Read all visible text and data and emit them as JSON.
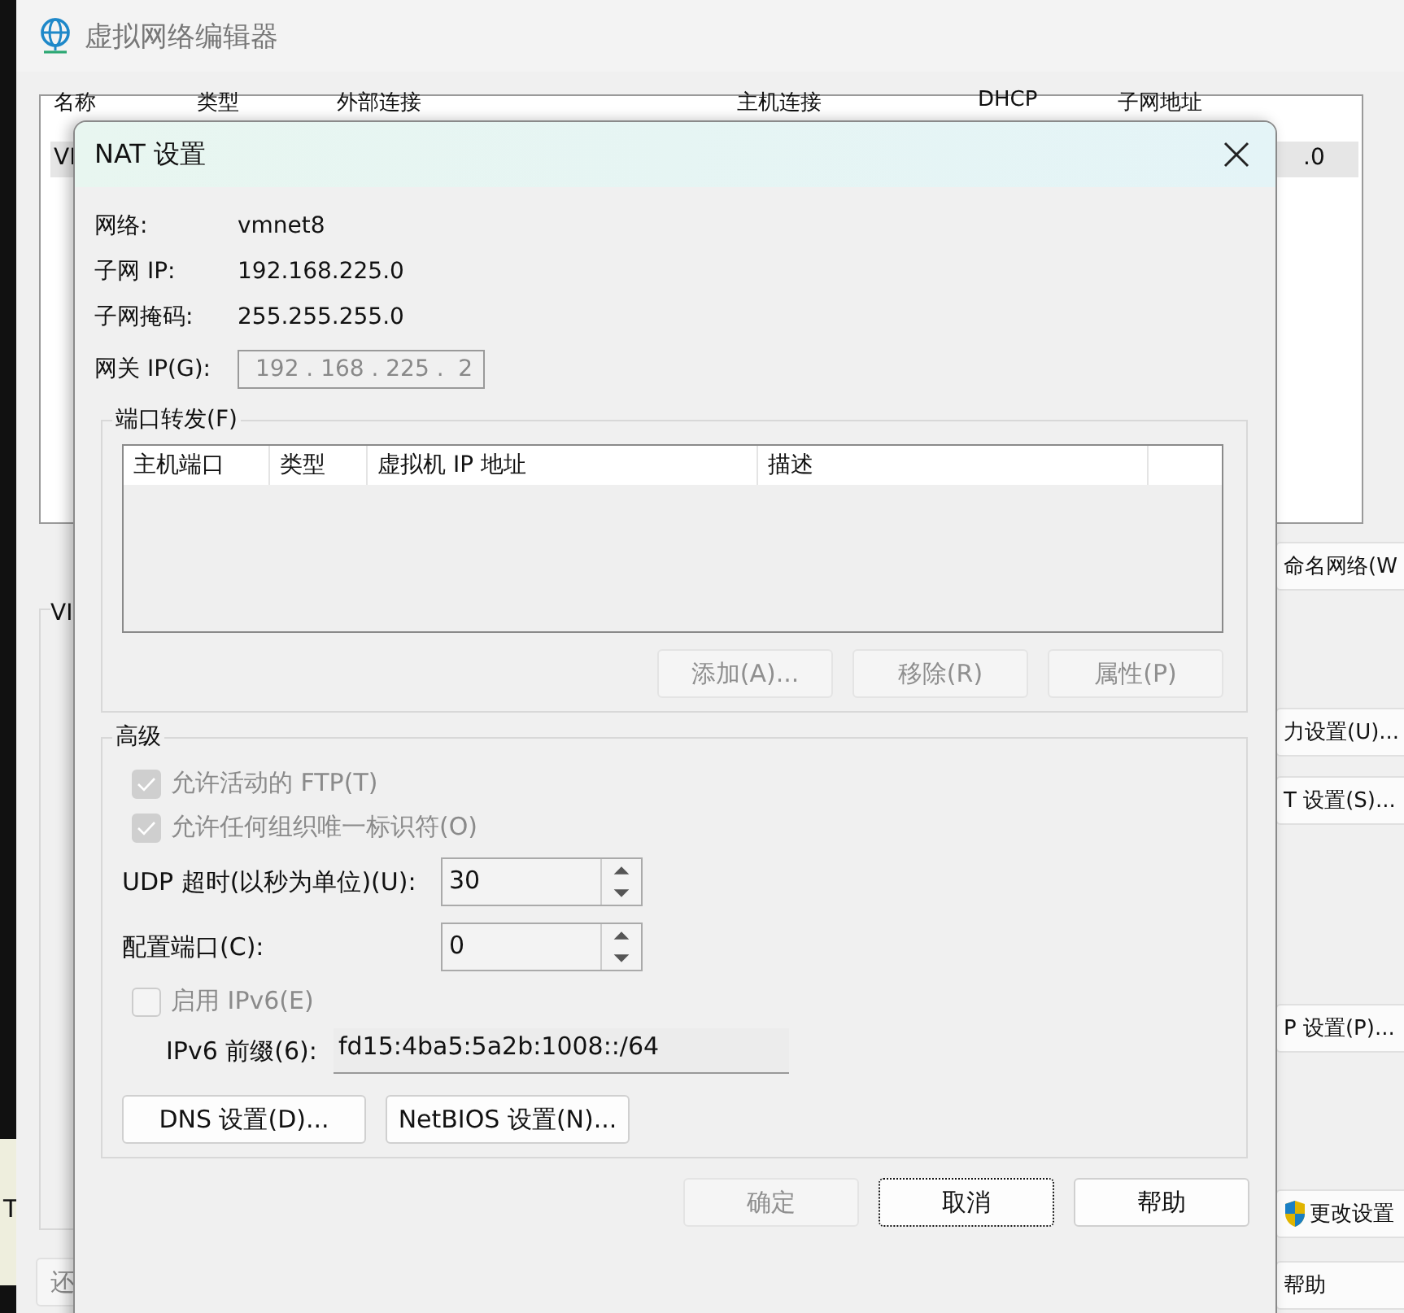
{
  "background_window": {
    "title": "虚拟网络编辑器",
    "table": {
      "columns": [
        "名称",
        "类型",
        "外部连接",
        "主机连接",
        "DHCP",
        "子网地址"
      ],
      "rows": [
        {
          "column_1": "VI",
          "column_6": ".0",
          "selected": true
        }
      ]
    },
    "group_label": "VI",
    "edge_text": "T",
    "buttons": [
      {
        "label": "命名网络(W",
        "kind": "plain"
      },
      {
        "label": "力设置(U)...",
        "kind": "plain"
      },
      {
        "label": "T 设置(S)...",
        "kind": "plain"
      },
      {
        "label": "P 设置(P)...",
        "kind": "plain"
      },
      {
        "label": "更改设置",
        "kind": "shield"
      },
      {
        "label": "帮助",
        "kind": "plain"
      }
    ],
    "bottom_left_button": "还"
  },
  "dialog": {
    "title": "NAT 设置",
    "info": [
      {
        "label": "网络:",
        "value": "vmnet8"
      },
      {
        "label": "子网 IP:",
        "value": "192.168.225.0"
      },
      {
        "label": "子网掩码:",
        "value": "255.255.255.0"
      }
    ],
    "gateway": {
      "label": "网关 IP(G):",
      "value": "192 . 168 . 225 .  2",
      "disabled": true
    },
    "port_forwarding": {
      "title": "端口转发(F)",
      "columns": [
        "主机端口",
        "类型",
        "虚拟机 IP 地址",
        "描述"
      ],
      "buttons": [
        {
          "label": "添加(A)...",
          "disabled": true
        },
        {
          "label": "移除(R)",
          "disabled": true
        },
        {
          "label": "属性(P)",
          "disabled": true
        }
      ]
    },
    "advanced": {
      "title": "高级",
      "checkboxes": [
        {
          "label": "允许活动的 FTP(T)",
          "checked": true,
          "disabled": true
        },
        {
          "label": "允许任何组织唯一标识符(O)",
          "checked": true,
          "disabled": true
        }
      ],
      "spinners": [
        {
          "label": "UDP 超时(以秒为单位)(U):",
          "value": "30"
        },
        {
          "label": "配置端口(C):",
          "value": "0"
        }
      ],
      "ipv6": {
        "label": "启用 IPv6(E)",
        "checked": false,
        "disabled": true
      },
      "prefix": {
        "label": "IPv6 前缀(6):",
        "value": "fd15:4ba5:5a2b:1008::/64",
        "disabled": true
      },
      "buttons": [
        {
          "label": "DNS 设置(D)...",
          "disabled": false
        },
        {
          "label": "NetBIOS 设置(N)...",
          "disabled": false
        }
      ]
    },
    "footer": [
      {
        "label": "确定",
        "disabled": true,
        "focused": false
      },
      {
        "label": "取消",
        "disabled": false,
        "focused": true
      },
      {
        "label": "帮助",
        "disabled": false,
        "focused": false
      }
    ]
  }
}
